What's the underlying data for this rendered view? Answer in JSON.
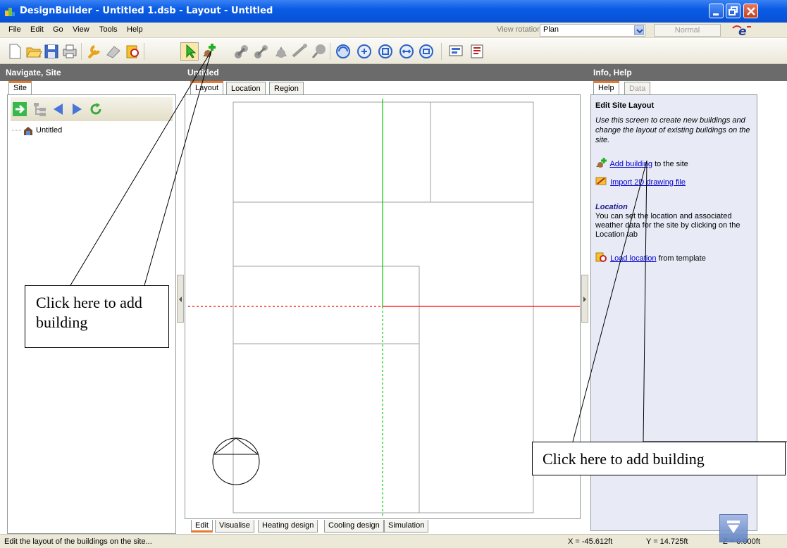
{
  "window": {
    "title": "DesignBuilder - Untitled 1.dsb - Layout - Untitled",
    "app_icon": "designbuilder-app-icon",
    "controls": [
      "minimize-icon",
      "restore-icon",
      "close-icon"
    ]
  },
  "menu": {
    "items": [
      "File",
      "Edit",
      "Go",
      "View",
      "Tools",
      "Help"
    ],
    "view_rotation_label": "View rotation",
    "view_rotation_value": "Plan",
    "mode_value": "Normal"
  },
  "panels": {
    "left_title": "Navigate, Site",
    "center_title": "Untitled",
    "right_title": "Info, Help"
  },
  "left": {
    "tabs": [
      "Site"
    ],
    "tree": [
      {
        "label": "Untitled",
        "icon": "building-icon"
      }
    ]
  },
  "center": {
    "tabs": [
      "Layout",
      "Location",
      "Region"
    ],
    "bottom_tabs": [
      "Edit",
      "Visualise",
      "Heating design",
      "Cooling design",
      "Simulation"
    ]
  },
  "right": {
    "tabs": [
      "Help",
      "Data"
    ],
    "heading": "Edit Site Layout",
    "intro": "Use this screen to create new buildings and change the layout of existing buildings on the site.",
    "add_building_link": "Add building",
    "add_building_suffix": " to the site",
    "import_link": "Import 2D drawing file",
    "location_heading": "Location",
    "location_text": "You can set the location and associated weather data for the site by clicking on the Location tab",
    "load_location_link": "Load location",
    "load_location_suffix": " from template"
  },
  "status": {
    "text": "Edit the layout of the buildings on the site...",
    "x": "X = -45.612ft",
    "y": "Y = 14.725ft",
    "z": "Z = 0.000ft"
  },
  "callouts": {
    "left": "Click here to add building",
    "right": "Click here to add building"
  },
  "colors": {
    "titlebar": "#0a5ce6",
    "tab_active_accent": "#e8792e",
    "axis_y": "#00cc00",
    "axis_x": "#ff0000",
    "link": "#0000cc"
  }
}
